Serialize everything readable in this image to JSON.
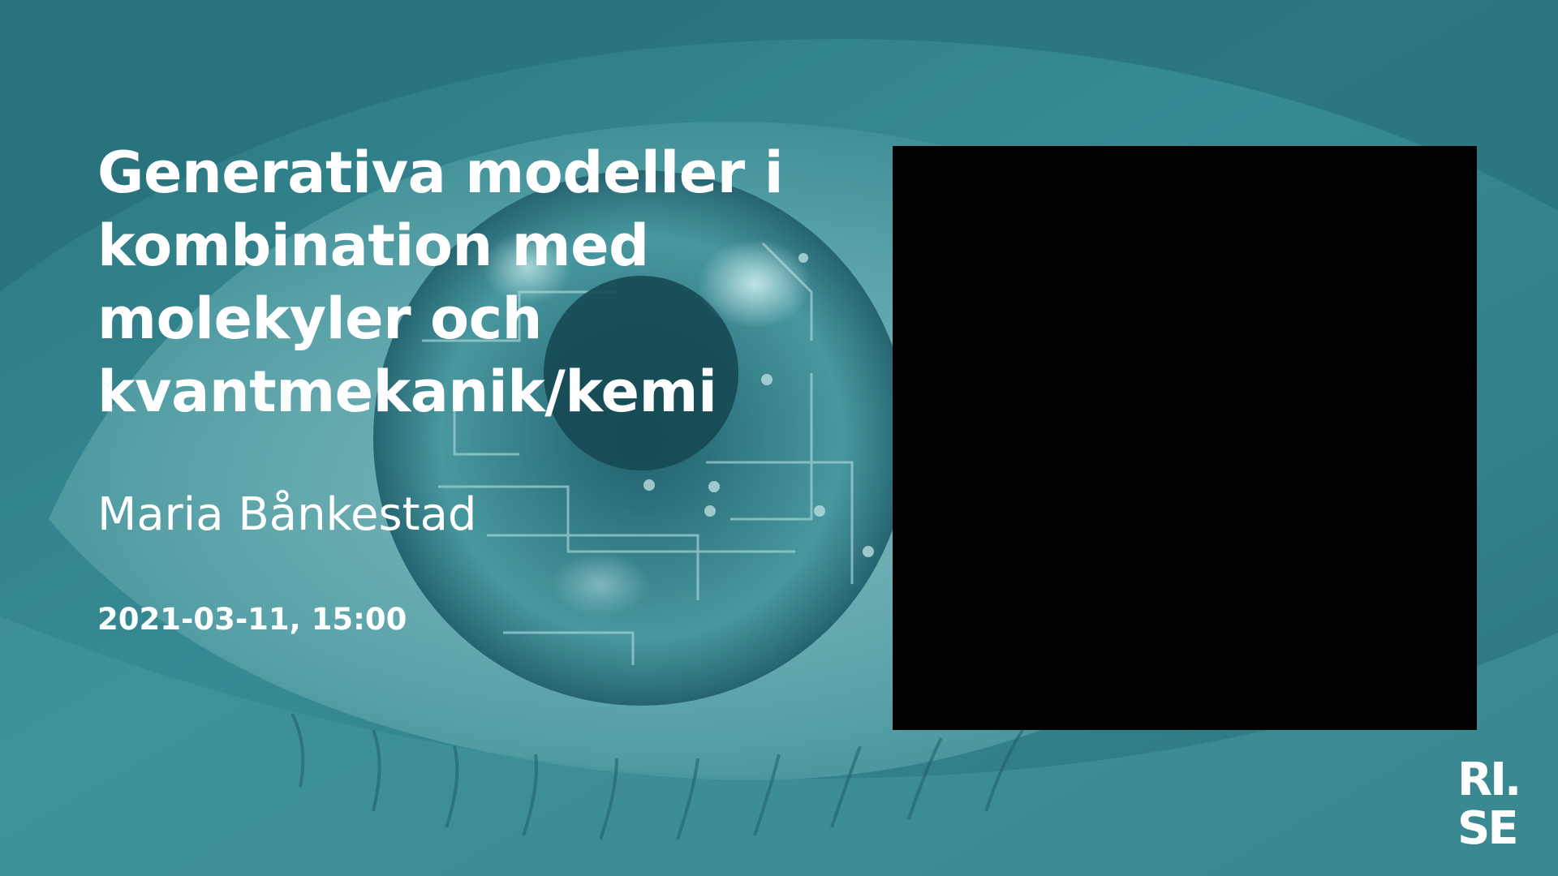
{
  "slide": {
    "title_lines": [
      "Generativa modeller i",
      "kombination med",
      "molekyler och",
      "kvantmekanik/kemi"
    ],
    "author": "Maria Bånkestad",
    "datetime": "2021-03-11, 15:00"
  },
  "logo": {
    "line1": "RI.",
    "line2": "SE"
  },
  "colors": {
    "background_teal": "#2f7e88",
    "text": "#ffffff",
    "video_placeholder": "#000000"
  },
  "icons": {
    "background": "eye-circuit-photo",
    "logo": "rise-logo"
  }
}
